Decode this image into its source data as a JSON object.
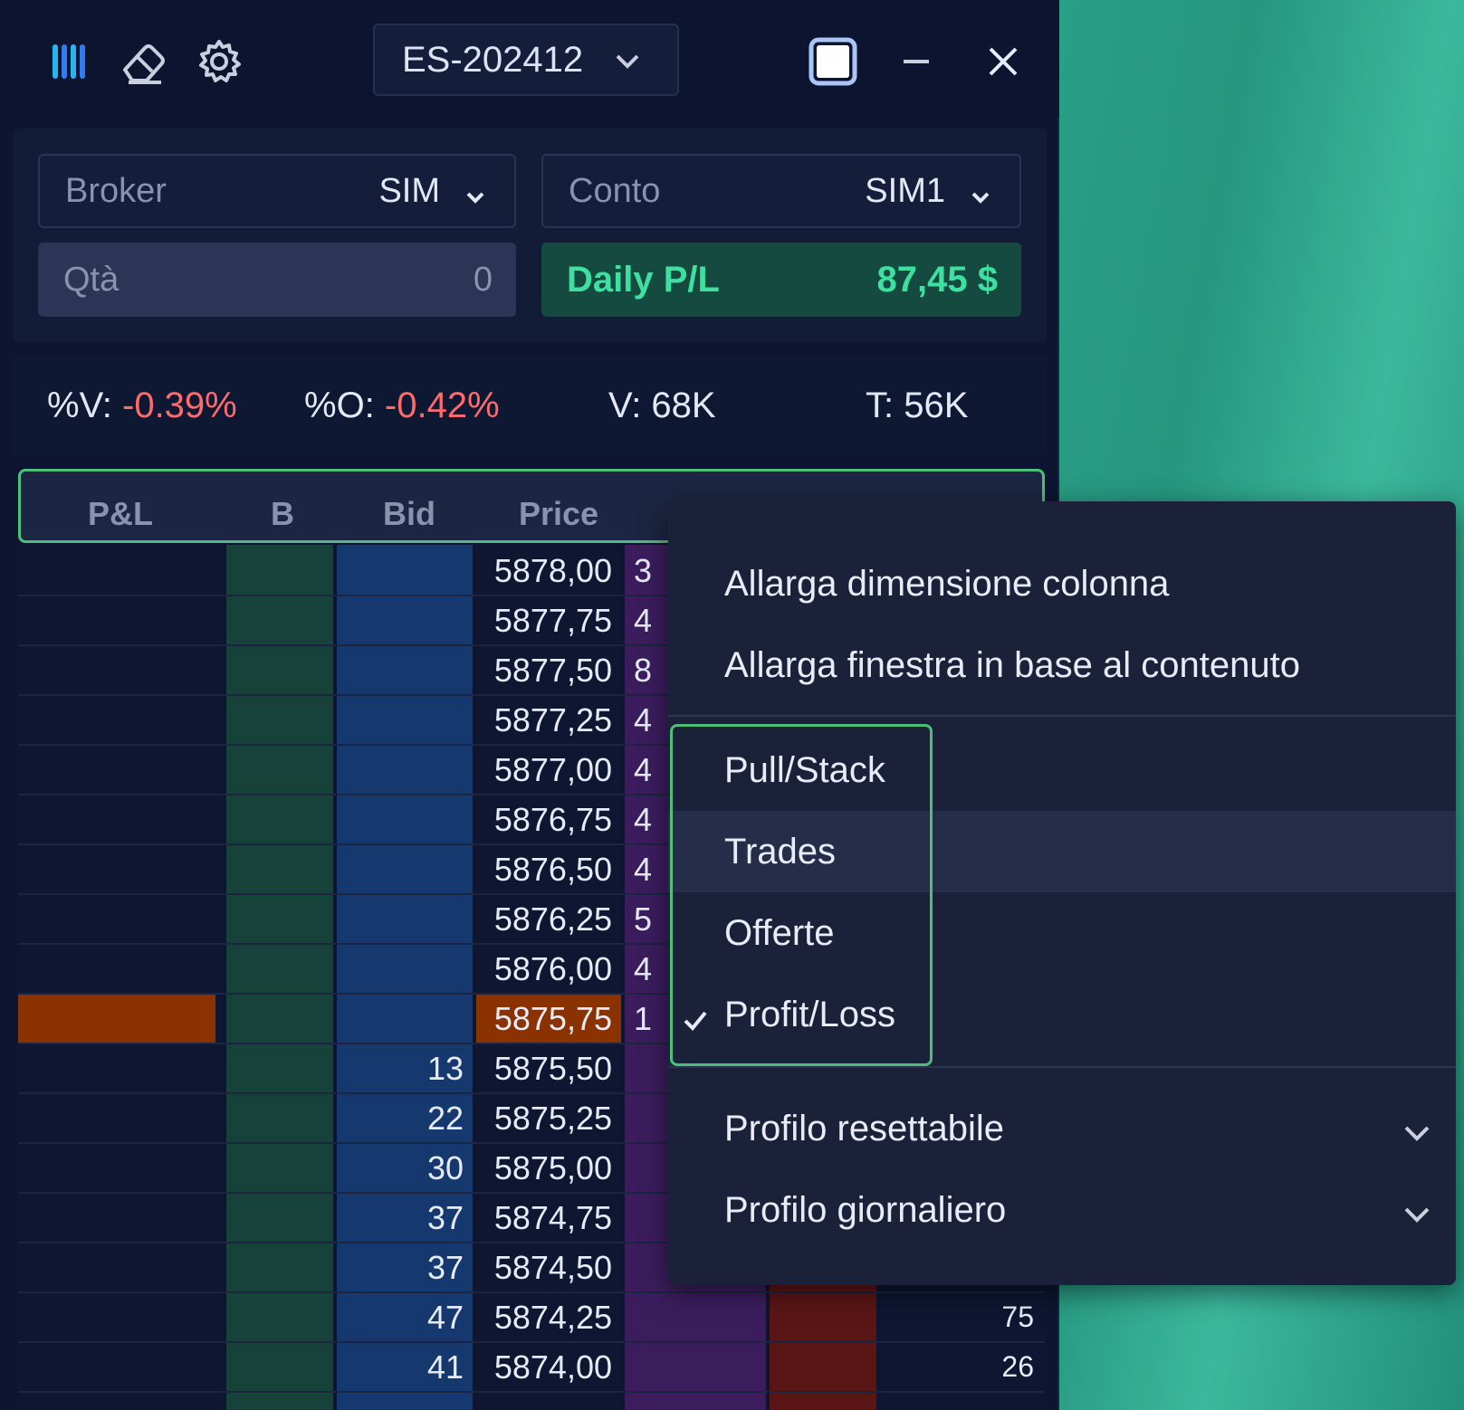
{
  "window": {
    "symbol": "ES-202412",
    "icons": [
      "columns-icon",
      "eraser-icon",
      "gear-icon",
      "chevron-down-icon",
      "maximize-icon",
      "minimize-icon",
      "close-icon"
    ]
  },
  "account": {
    "broker_label": "Broker",
    "broker_value": "SIM",
    "conto_label": "Conto",
    "conto_value": "SIM1",
    "qty_label": "Qtà",
    "qty_value": "0",
    "pl_label": "Daily P/L",
    "pl_value": "87,45 $"
  },
  "stats": {
    "v_pct_label": "%V:",
    "v_pct_value": "-0.39%",
    "o_pct_label": "%O:",
    "o_pct_value": "-0.42%",
    "volume": "V: 68K",
    "trades": "T: 56K"
  },
  "ladder": {
    "headers": {
      "pl": "P&L",
      "b": "B",
      "bid": "Bid",
      "price": "Price"
    },
    "rows": [
      {
        "price": "5878,00",
        "bid": "",
        "ask": "3",
        "vp": ""
      },
      {
        "price": "5877,75",
        "bid": "",
        "ask": "4",
        "vp": ""
      },
      {
        "price": "5877,50",
        "bid": "",
        "ask": "8",
        "vp": ""
      },
      {
        "price": "5877,25",
        "bid": "",
        "ask": "4",
        "vp": ""
      },
      {
        "price": "5877,00",
        "bid": "",
        "ask": "4",
        "vp": ""
      },
      {
        "price": "5876,75",
        "bid": "",
        "ask": "4",
        "vp": ""
      },
      {
        "price": "5876,50",
        "bid": "",
        "ask": "4",
        "vp": ""
      },
      {
        "price": "5876,25",
        "bid": "",
        "ask": "5",
        "vp": ""
      },
      {
        "price": "5876,00",
        "bid": "",
        "ask": "4",
        "vp": ""
      },
      {
        "price": "5875,75",
        "bid": "",
        "ask": "1",
        "vp": "",
        "current": true
      },
      {
        "price": "5875,50",
        "bid": "13",
        "ask": "",
        "vp": ""
      },
      {
        "price": "5875,25",
        "bid": "22",
        "ask": "",
        "vp": ""
      },
      {
        "price": "5875,00",
        "bid": "30",
        "ask": "",
        "vp": ""
      },
      {
        "price": "5874,75",
        "bid": "37",
        "ask": "",
        "vp": ""
      },
      {
        "price": "5874,50",
        "bid": "37",
        "ask": "",
        "vp": ""
      },
      {
        "price": "5874,25",
        "bid": "47",
        "ask": "",
        "vp": "75"
      },
      {
        "price": "5874,00",
        "bid": "41",
        "ask": "",
        "vp": "26"
      }
    ]
  },
  "context_menu": {
    "items": [
      {
        "label": "Allarga dimensione colonna"
      },
      {
        "label": "Allarga finestra in base al contenuto"
      },
      {
        "label": "Pull/Stack",
        "checked": false
      },
      {
        "label": "Trades",
        "checked": false,
        "hover": true
      },
      {
        "label": "Offerte",
        "checked": false
      },
      {
        "label": "Profit/Loss",
        "checked": true
      },
      {
        "label": "Profilo resettabile",
        "submenu": true
      },
      {
        "label": "Profilo giornaliero",
        "submenu": true
      }
    ]
  },
  "colors": {
    "accent_green": "#3ee0a0",
    "negative": "#ff6b6b",
    "highlight_border": "#4cc07a",
    "current_price": "#8a3200",
    "bid_column": "#15386e",
    "b_column": "#17423a",
    "ask_column": "#3b1d5e",
    "sell_column": "#5a1515"
  }
}
